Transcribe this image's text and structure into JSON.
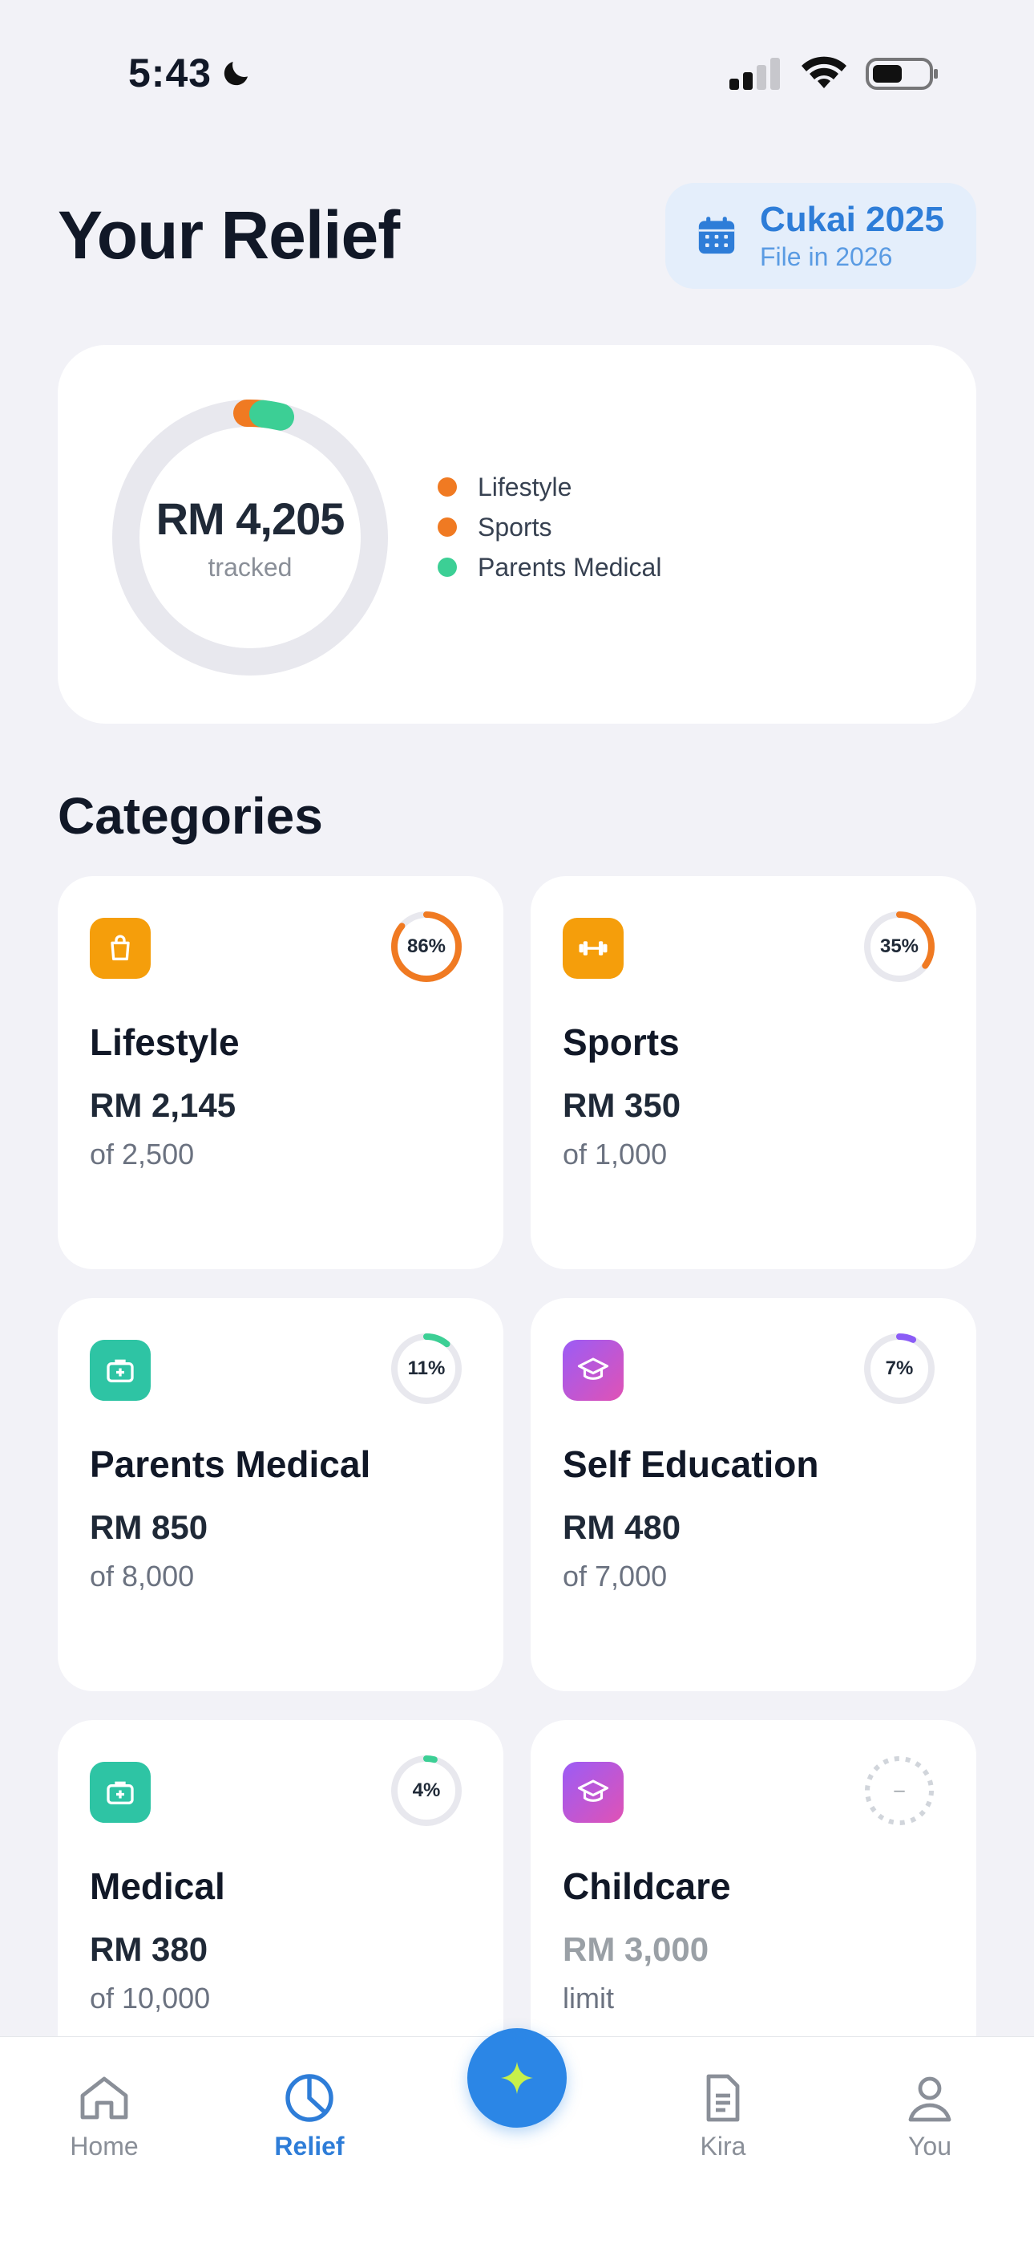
{
  "status_bar": {
    "time": "5:43"
  },
  "header": {
    "title": "Your Relief",
    "year_chip": {
      "title": "Cukai 2025",
      "subtitle": "File in 2026"
    }
  },
  "summary": {
    "amount": "RM 4,205",
    "caption": "tracked",
    "legend": [
      {
        "label": "Lifestyle",
        "color": "#f07a22"
      },
      {
        "label": "Sports",
        "color": "#f07a22"
      },
      {
        "label": "Parents Medical",
        "color": "#3ccf95"
      }
    ]
  },
  "categories": {
    "title": "Categories",
    "items": [
      {
        "name": "Lifestyle",
        "amount": "RM 2,145",
        "limit": "of 2,500",
        "percent_label": "86%",
        "percent": 86,
        "ring_color": "#f07a22",
        "icon": "shopping-bag-icon",
        "icon_color": "#f59e0b"
      },
      {
        "name": "Sports",
        "amount": "RM 350",
        "limit": "of 1,000",
        "percent_label": "35%",
        "percent": 35,
        "ring_color": "#f07a22",
        "icon": "dumbbell-icon",
        "icon_color": "#f59e0b"
      },
      {
        "name": "Parents Medical",
        "amount": "RM 850",
        "limit": "of 8,000",
        "percent_label": "11%",
        "percent": 11,
        "ring_color": "#3ccf95",
        "icon": "medical-kit-icon",
        "icon_color": "#2ec4a4"
      },
      {
        "name": "Self Education",
        "amount": "RM 480",
        "limit": "of 7,000",
        "percent_label": "7%",
        "percent": 7,
        "ring_color": "#8b5cf6",
        "icon": "graduation-cap-icon",
        "icon_color": "#b44fd8"
      },
      {
        "name": "Medical",
        "amount": "RM 380",
        "limit": "of 10,000",
        "percent_label": "4%",
        "percent": 4,
        "ring_color": "#3ccf95",
        "icon": "medical-kit-icon",
        "icon_color": "#2ec4a4"
      },
      {
        "name": "Childcare",
        "amount": "RM 3,000",
        "limit": "limit",
        "percent_label": "–",
        "percent": 0,
        "ring_color": "#d1d5db",
        "icon": "graduation-cap-icon",
        "icon_color": "#b44fd8"
      }
    ]
  },
  "tab_bar": {
    "tabs": [
      {
        "label": "Home",
        "icon": "home-icon"
      },
      {
        "label": "Relief",
        "icon": "pie-chart-icon",
        "active": true
      },
      {
        "label": "Kira",
        "icon": "document-icon"
      },
      {
        "label": "You",
        "icon": "user-icon"
      }
    ],
    "fab_icon": "sparkle-icon"
  }
}
